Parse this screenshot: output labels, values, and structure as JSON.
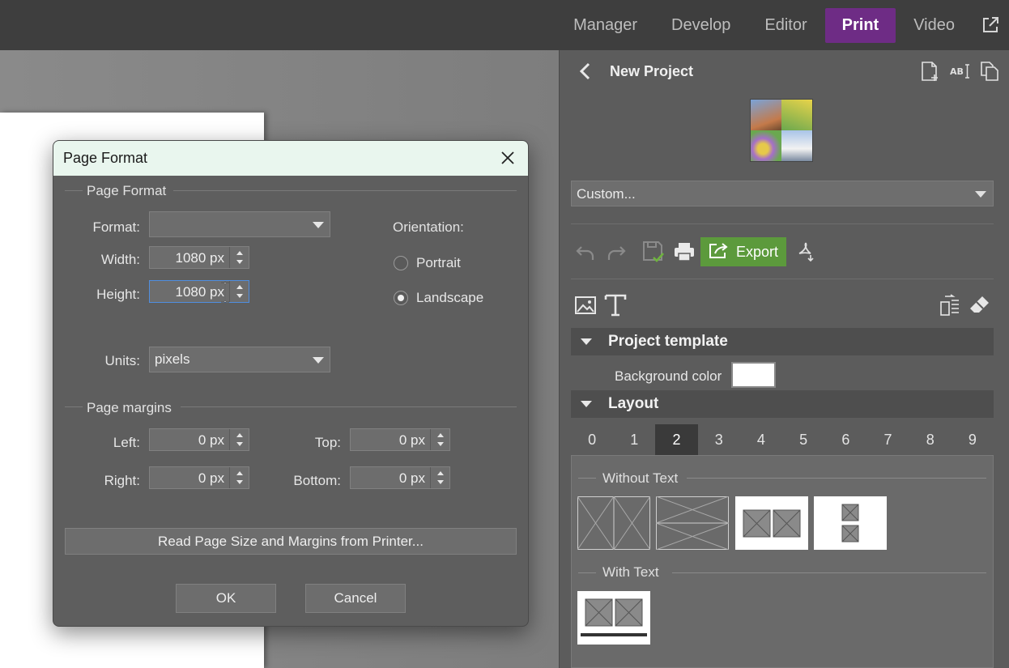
{
  "topnav": {
    "tabs": [
      {
        "label": "Manager"
      },
      {
        "label": "Develop"
      },
      {
        "label": "Editor"
      },
      {
        "label": "Print"
      },
      {
        "label": "Video"
      }
    ],
    "active_tab": "Print"
  },
  "panel": {
    "title": "New Project",
    "preset_value": "Custom...",
    "export_label": "Export",
    "sections": {
      "template": "Project template",
      "layout": "Layout"
    },
    "background_color_label": "Background color",
    "background_color": "#ffffff",
    "layout_numbers": [
      "0",
      "1",
      "2",
      "3",
      "4",
      "5",
      "6",
      "7",
      "8",
      "9"
    ],
    "selected_layout_number": "2",
    "groups": {
      "without_text": "Without Text",
      "with_text": "With Text"
    }
  },
  "dialog": {
    "title": "Page Format",
    "fieldset_page_format": "Page Format",
    "format_label": "Format:",
    "format_value": "",
    "width_label": "Width:",
    "width_value": "1080 px",
    "height_label": "Height:",
    "height_value": "1080 px",
    "units_label": "Units:",
    "units_value": "pixels",
    "orientation_label": "Orientation:",
    "portrait_label": "Portrait",
    "landscape_label": "Landscape",
    "orientation_selected": "Landscape",
    "fieldset_margins": "Page margins",
    "left_label": "Left:",
    "left_value": "0 px",
    "top_label": "Top:",
    "top_value": "0 px",
    "right_label": "Right:",
    "right_value": "0 px",
    "bottom_label": "Bottom:",
    "bottom_value": "0 px",
    "read_printer_label": "Read Page Size and Margins from Printer...",
    "ok_label": "OK",
    "cancel_label": "Cancel"
  },
  "colors": {
    "active_tab": "#6e2c85",
    "export_button": "#5c9a3c",
    "dialog_title_bg": "#e9f6ee"
  }
}
